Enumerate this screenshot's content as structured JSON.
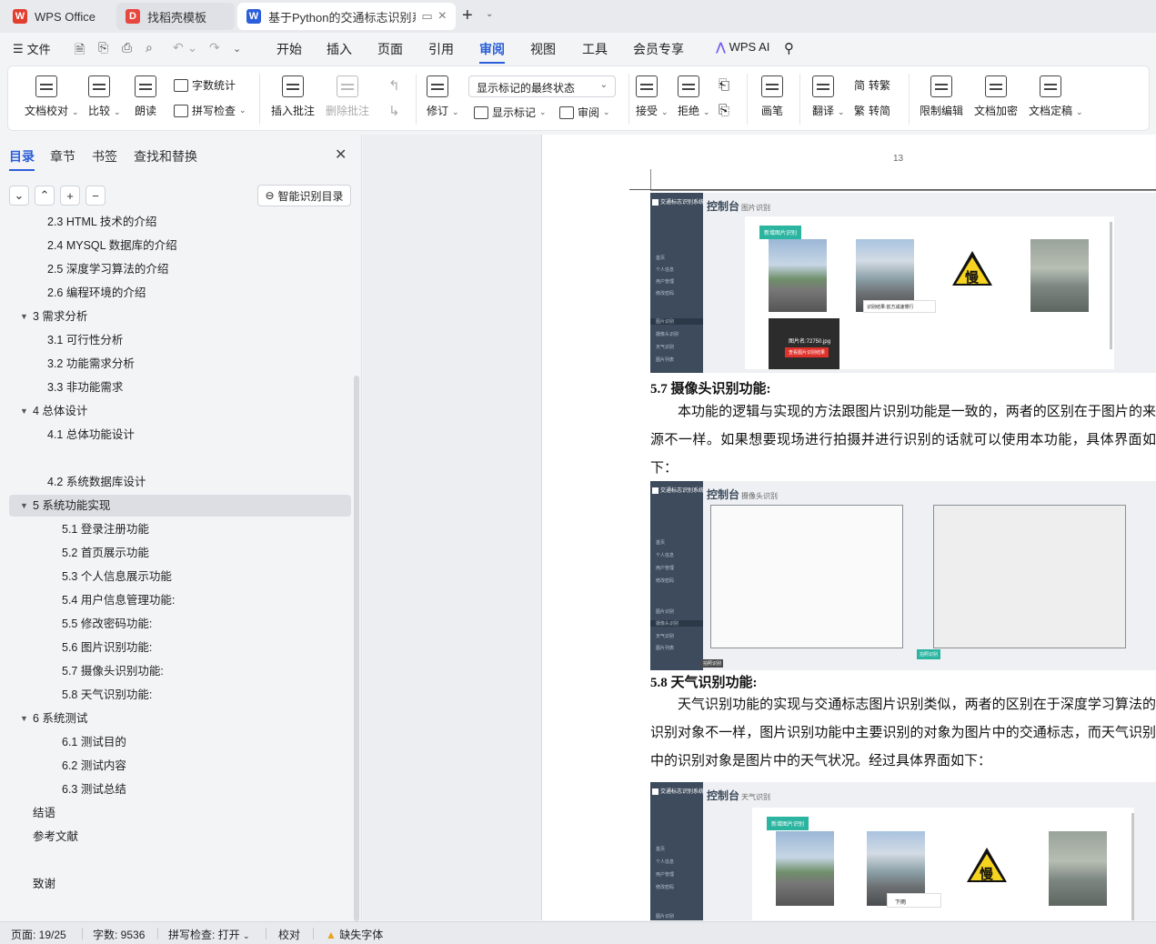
{
  "tabs": [
    {
      "label": "WPS Office",
      "logo": "W",
      "color": "#e33d2e"
    },
    {
      "label": "找稻壳模板",
      "logo": "D",
      "color": "#e8473e"
    },
    {
      "label": "基于Python的交通标志识别系",
      "logo": "W",
      "color": "#2b5ed8"
    }
  ],
  "menu": {
    "file": "文件",
    "items": [
      "开始",
      "插入",
      "页面",
      "引用",
      "审阅",
      "视图",
      "工具",
      "会员专享"
    ],
    "active": "审阅",
    "wps_ai": "WPS AI"
  },
  "ribbon": {
    "doc_check": "文档校对",
    "compare": "比较",
    "read_aloud": "朗读",
    "word_count": "字数统计",
    "spell_check": "拼写检查",
    "insert_comment": "插入批注",
    "delete_comment": "删除批注",
    "revise": "修订",
    "markup_state": "显示标记的最终状态",
    "show_markup": "显示标记",
    "review": "审阅",
    "accept": "接受",
    "reject": "拒绝",
    "pen": "画笔",
    "translate": "翻译",
    "to_traditional": "转繁",
    "to_simplified": "转简",
    "restrict_edit": "限制编辑",
    "doc_encrypt": "文档加密",
    "doc_finalize": "文档定稿"
  },
  "sidebar": {
    "tabs": [
      "目录",
      "章节",
      "书签",
      "查找和替换"
    ],
    "smart_toc": "智能识别目录",
    "toc": [
      {
        "text": "2.3 HTML 技术的介绍",
        "level": 2
      },
      {
        "text": "2.4 MYSQL 数据库的介绍",
        "level": 2
      },
      {
        "text": "2.5  深度学习算法的介绍",
        "level": 2
      },
      {
        "text": "2.6  编程环境的介绍",
        "level": 2
      },
      {
        "text": "3  需求分析",
        "level": 1,
        "expanded": true
      },
      {
        "text": "3.1  可行性分析",
        "level": 2
      },
      {
        "text": "3.2  功能需求分析",
        "level": 2
      },
      {
        "text": "3.3  非功能需求",
        "level": 2
      },
      {
        "text": "4  总体设计",
        "level": 1,
        "expanded": true
      },
      {
        "text": "4.1  总体功能设计",
        "level": 2
      },
      {
        "text": "",
        "level": 2
      },
      {
        "text": "4.2  系统数据库设计",
        "level": 2
      },
      {
        "text": "5  系统功能实现",
        "level": 1,
        "expanded": true,
        "selected": true
      },
      {
        "text": "5.1  登录注册功能",
        "level": 3
      },
      {
        "text": "5.2  首页展示功能",
        "level": 3
      },
      {
        "text": "5.3  个人信息展示功能",
        "level": 3
      },
      {
        "text": "5.4  用户信息管理功能:",
        "level": 3
      },
      {
        "text": "5.5  修改密码功能:",
        "level": 3
      },
      {
        "text": "5.6 图片识别功能:",
        "level": 3
      },
      {
        "text": "5.7 摄像头识别功能:",
        "level": 3
      },
      {
        "text": "5.8 天气识别功能:",
        "level": 3
      },
      {
        "text": "6  系统测试",
        "level": 1,
        "expanded": true
      },
      {
        "text": "6.1  测试目的",
        "level": 3
      },
      {
        "text": "6.2  测试内容",
        "level": 3
      },
      {
        "text": "6.3  测试总结",
        "level": 3
      },
      {
        "text": "结语",
        "level": 0
      },
      {
        "text": "参考文献",
        "level": 0
      },
      {
        "text": "",
        "level": 0
      },
      {
        "text": "致谢",
        "level": 0
      }
    ]
  },
  "document": {
    "page_number": "13",
    "sec57_title": "5.7 摄像头识别功能:",
    "sec57_body": "本功能的逻辑与实现的方法跟图片识别功能是一致的，两者的区别在于图片的来源不一样。如果想要现场进行拍摄并进行识别的话就可以使用本功能，具体界面如下：",
    "sec58_title": "5.8 天气识别功能:",
    "sec58_body": "天气识别功能的实现与交通标志图片识别类似，两者的区别在于深度学习算法的识别对象不一样，图片识别功能中主要识别的对象为图片中的交通标志，而天气识别中的识别对象是图片中的天气状况。经过具体界面如下：",
    "fig1": {
      "brand": "交通标志识别系统",
      "title": "控制台",
      "subtitle": "图片识别",
      "button": "新增图片识别",
      "sign_char": "慢",
      "caption": "图片名:72750.jpg",
      "red_btn": "查看图片识别结果",
      "bubble": "识别结果:前方减速慢行"
    },
    "fig2": {
      "brand": "交通标志识别系统",
      "title": "控制台",
      "subtitle": "摄像头识别",
      "snap_btn": "拍照识别",
      "hint": "拍照识别"
    },
    "fig3": {
      "brand": "交通标志识别系统",
      "title": "控制台",
      "subtitle": "天气识别",
      "button": "新增图片识别",
      "sign_char": "慢",
      "bubble": "下雨"
    },
    "nav_items": [
      "首页",
      "个人信息",
      "用户管理",
      "修改密码",
      "图片识别",
      "摄像头识别",
      "天气识别",
      "图片列表"
    ]
  },
  "status": {
    "page": "页面: 19/25",
    "words": "字数: 9536",
    "spell": "拼写检查: 打开",
    "proof": "校对",
    "missing_font": "缺失字体"
  }
}
